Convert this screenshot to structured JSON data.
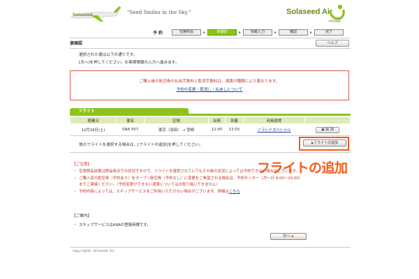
{
  "header": {
    "slogan": "\"Seed Smiles in the Sky.\"",
    "brand_name": "Solaseed Air",
    "brand_sub": "+HOME",
    "colors": {
      "brand_green": "#8cc31a",
      "accent_orange": "#f25c19"
    }
  },
  "steps": {
    "label": "予約",
    "items": [
      {
        "label": "空席照会",
        "active": false
      },
      {
        "label": "便選択",
        "active": true
      },
      {
        "label": "情報入力",
        "active": false
      },
      {
        "label": "確認",
        "active": false
      },
      {
        "label": "完了",
        "active": false
      }
    ]
  },
  "page": {
    "title": "便確認",
    "help_label": "ヘルプ",
    "intro_line1": "選択された便は以下の通りです。",
    "intro_line2": "[次へ]を押してください。お客様情報の入力へ進みます。"
  },
  "notice": {
    "text": "ご購入後の航空券の払戻手数料と取消手数料は、運賃の種類により異なります。",
    "link": "予約の変更・取消し・払戻しについて"
  },
  "flight": {
    "tab_label": "フライト",
    "columns": [
      "搭乗日",
      "便名",
      "区間",
      "出発",
      "到着",
      "利用運賃",
      ""
    ],
    "rows": [
      {
        "date": "12月16日(土)",
        "flight_no": "SNA 057",
        "route": "東京（羽田） → 宮崎",
        "depart": "12:00",
        "arrive": "13:55",
        "fare": "ソラシドスペシャル",
        "delete_label": "削 除"
      }
    ],
    "add_instruction": "他のフライトを選択する場合は、[フライトの追加]を押してください。",
    "add_button": "フライトの追加",
    "callout": "フライトの追加"
  },
  "notes": {
    "caution_head": "【ご注意】",
    "caution_items": [
      "空席照会結果は照会時点での状況ですので、フライトを選択されていてもその後の状況によっては予約できない場合がございます。",
      "ご購入済の航空券（予約あり）をオープン航空券（予約なし）に変更をご希望される場合は、予約センター（月〜日 8:00〜20:00）までご連絡ください。（予約変更ができない運賃についてはお取り扱いできません）",
      "予約内容によっては、スキップサービスをご利用いただけない場合がございます。詳細は"
    ],
    "caution_link": "こちら",
    "info_head": "【ご案内】",
    "info_items": [
      "スキップサービスはANAの登録商標です。"
    ]
  },
  "footer": {
    "next_label": "次へ",
    "copyright": "Copyright© Solaseed Air"
  }
}
